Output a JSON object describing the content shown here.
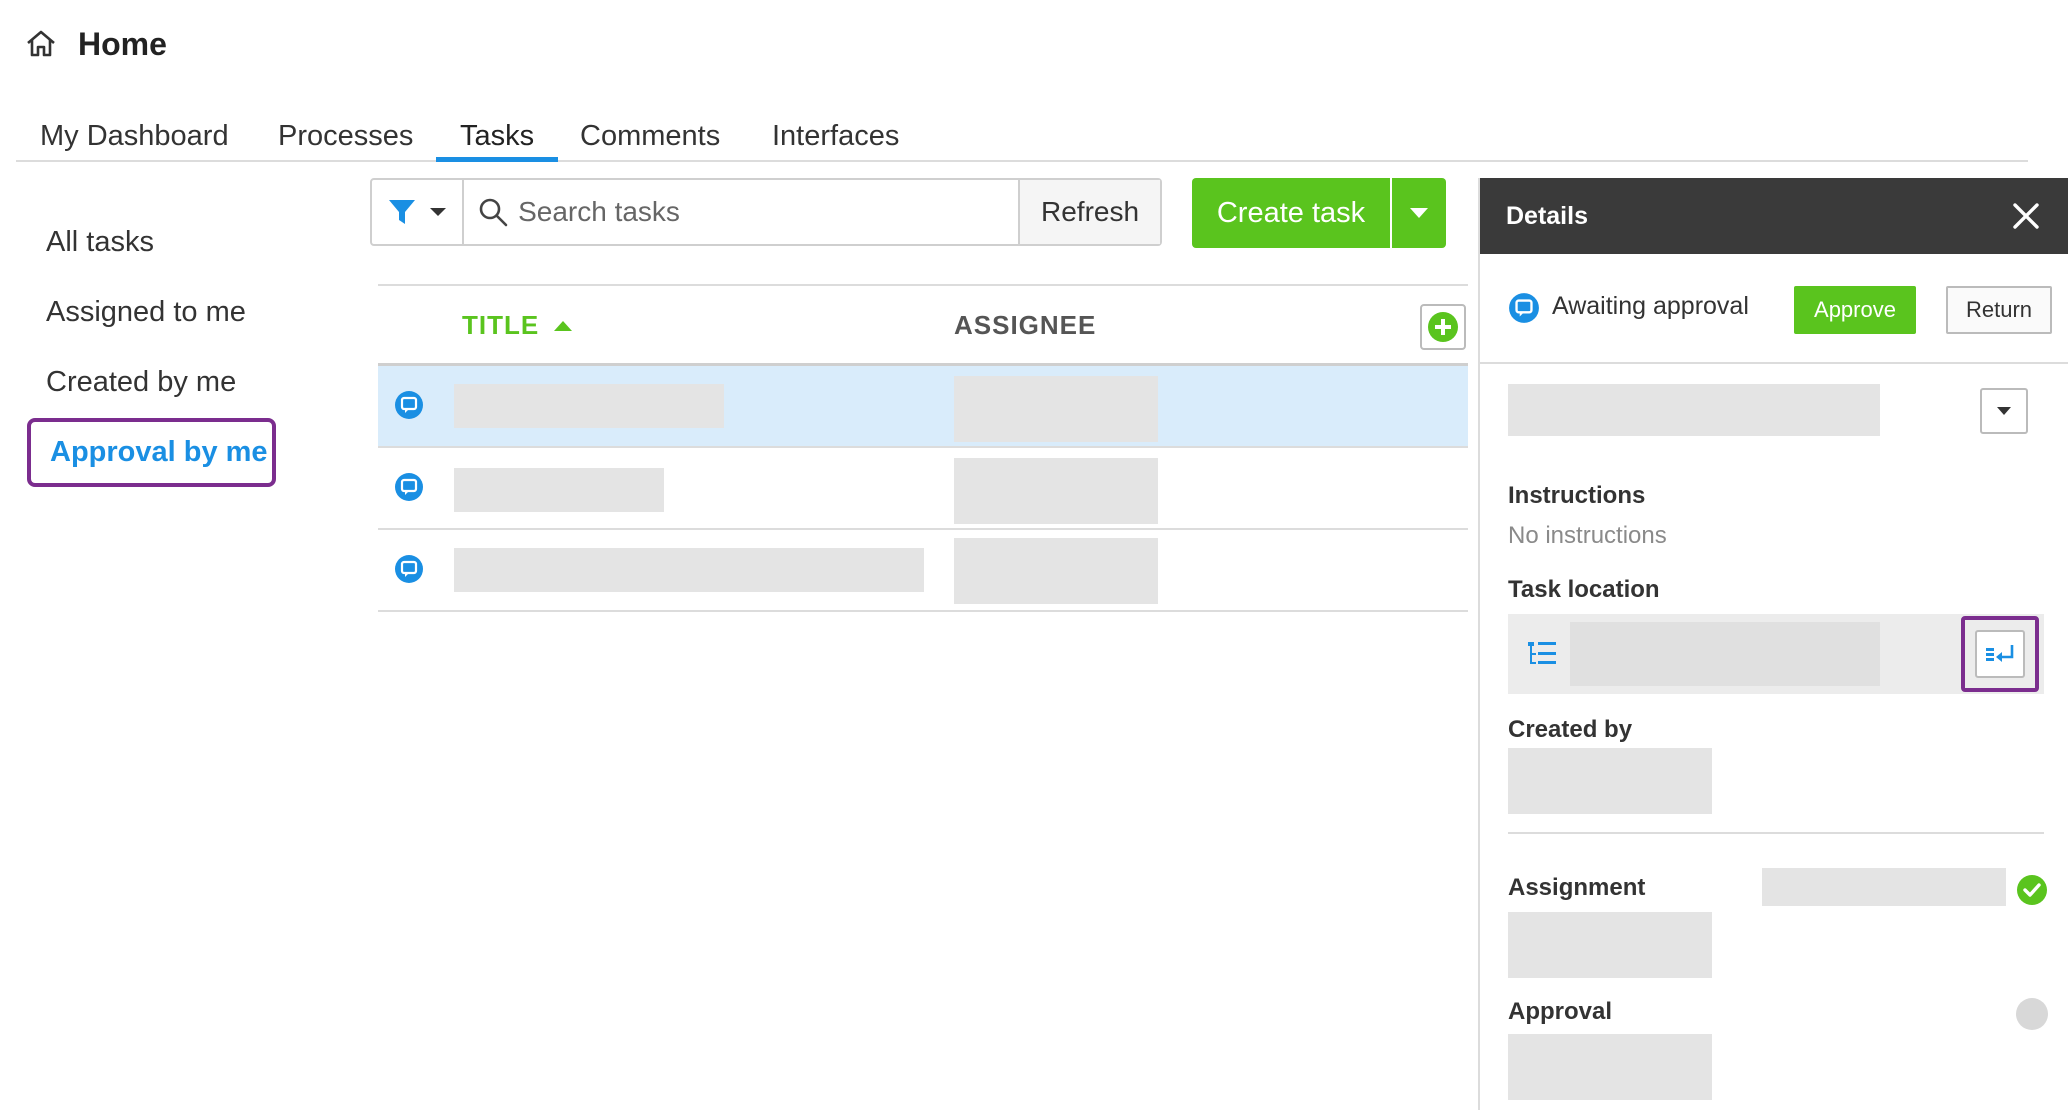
{
  "header": {
    "title": "Home",
    "icon": "home-icon"
  },
  "tabs": [
    {
      "label": "My Dashboard"
    },
    {
      "label": "Processes"
    },
    {
      "label": "Tasks",
      "active": true
    },
    {
      "label": "Comments"
    },
    {
      "label": "Interfaces"
    }
  ],
  "sidebar": {
    "items": [
      {
        "label": "All tasks"
      },
      {
        "label": "Assigned to me"
      },
      {
        "label": "Created by me"
      },
      {
        "label": "Approval by me",
        "active": true
      }
    ]
  },
  "toolbar": {
    "search_placeholder": "Search tasks",
    "refresh_label": "Refresh",
    "create_label": "Create task"
  },
  "table": {
    "columns": {
      "title": "TITLE",
      "assignee": "ASSIGNEE"
    },
    "sort": "ascending",
    "row_count": 3
  },
  "details": {
    "title": "Details",
    "status": "Awaiting approval",
    "approve_label": "Approve",
    "return_label": "Return",
    "instructions_label": "Instructions",
    "instructions_value": "No instructions",
    "task_location_label": "Task location",
    "created_by_label": "Created by",
    "assignment_label": "Assignment",
    "approval_label": "Approval"
  },
  "colors": {
    "accent_blue": "#1a8fe3",
    "accent_green": "#5ac41e",
    "highlight_purple": "#7b2d8e",
    "details_header": "#3a3a3a",
    "selected_row": "#d9ecfb"
  }
}
